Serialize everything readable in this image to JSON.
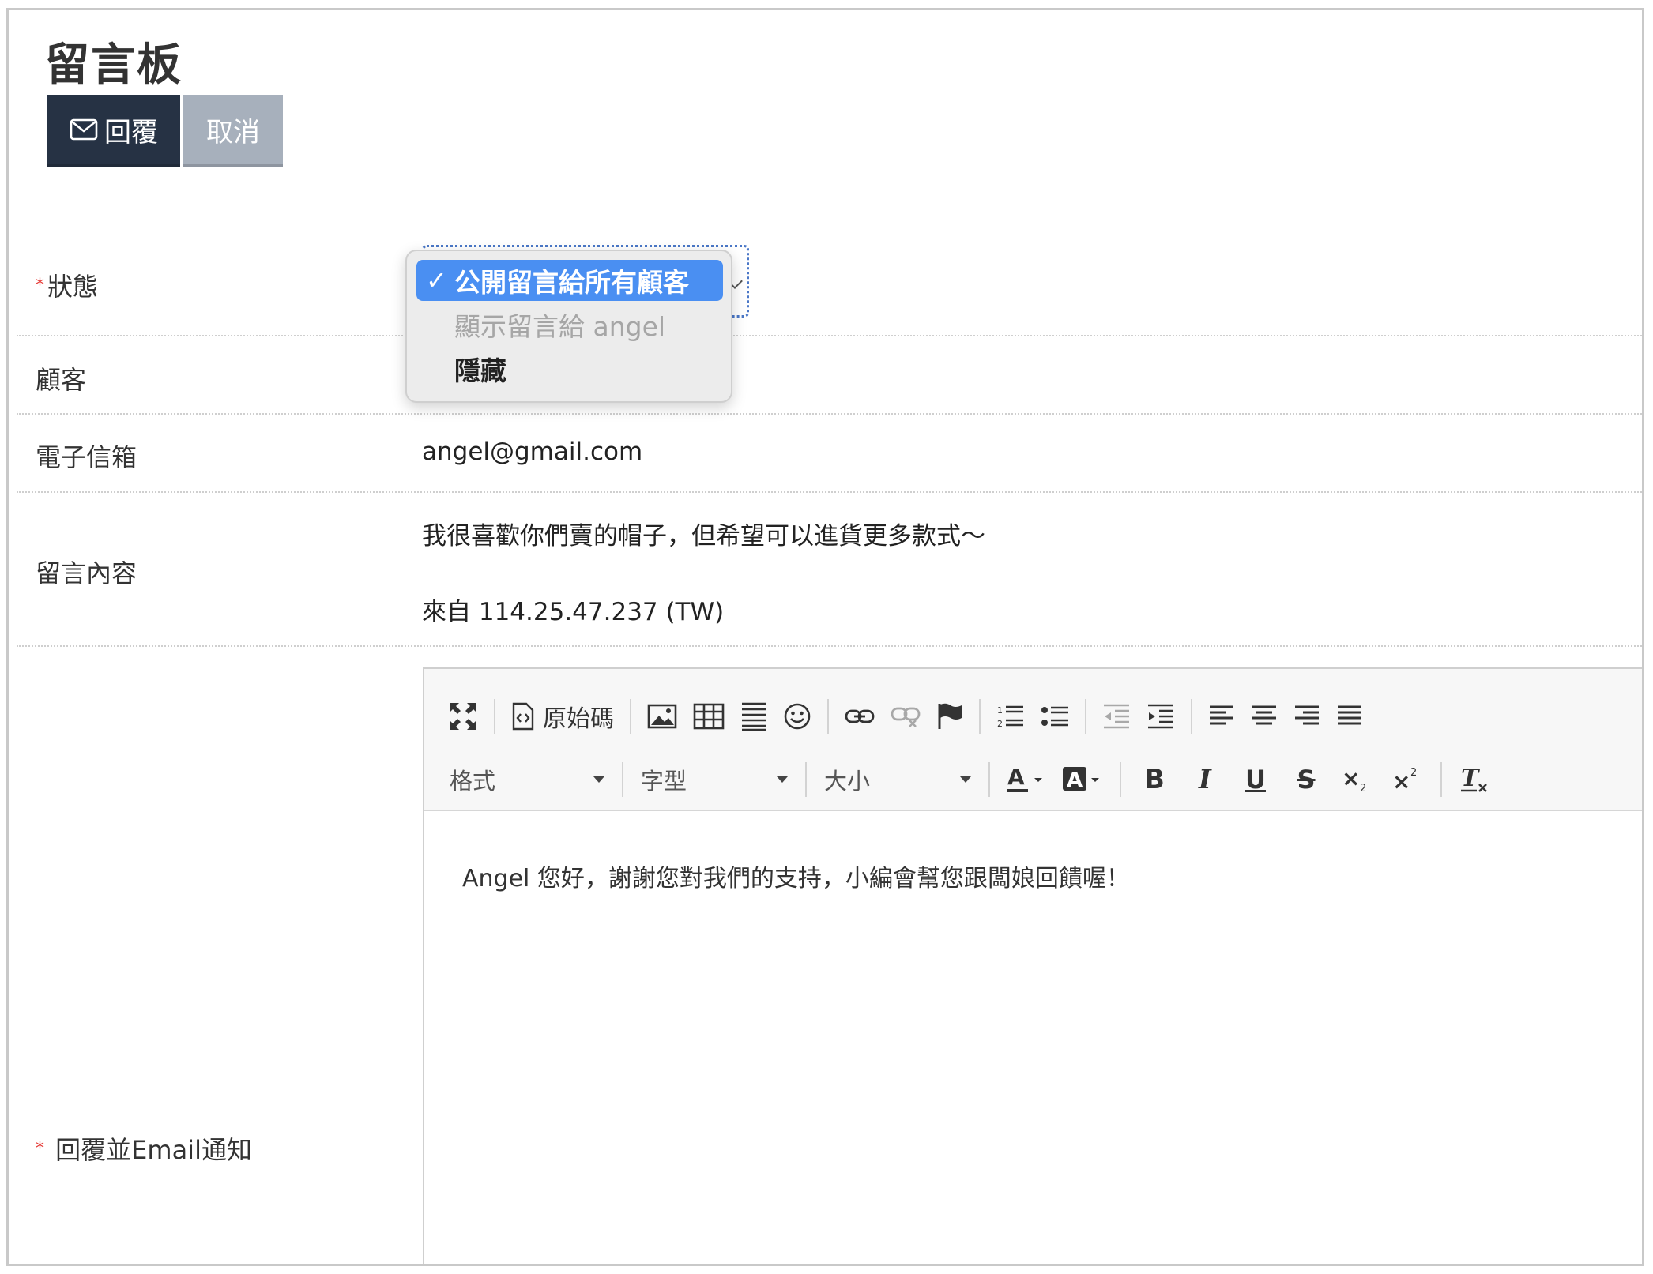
{
  "page": {
    "title": "留言板"
  },
  "actions": {
    "reply_label": "回覆",
    "cancel_label": "取消"
  },
  "form": {
    "status": {
      "label": "狀態",
      "options": [
        "公開留言給所有顧客",
        "顯示留言給 angel",
        "隱藏"
      ],
      "selected_index": 0,
      "disabled_index": 1
    },
    "customer": {
      "label": "顧客"
    },
    "email": {
      "label": "電子信箱",
      "value": "angel@gmail.com"
    },
    "message": {
      "label": "留言內容",
      "text": "我很喜歡你們賣的帽子，但希望可以進貨更多款式～",
      "origin": "來自 114.25.47.237 (TW)"
    },
    "reply": {
      "label": "回覆並Email通知",
      "content": "Angel 您好，謝謝您對我們的支持，小編會幫您跟闆娘回饋喔！"
    }
  },
  "editor": {
    "source_label": "原始碼",
    "format_label": "格式",
    "font_label": "字型",
    "size_label": "大小",
    "icons": [
      "maximize-icon",
      "source-icon",
      "image-icon",
      "table-icon",
      "horizontal-rule-icon",
      "smiley-icon",
      "link-icon",
      "unlink-icon",
      "anchor-flag-icon",
      "numbered-list-icon",
      "bulleted-list-icon",
      "outdent-icon",
      "indent-icon",
      "align-left-icon",
      "align-center-icon",
      "align-right-icon",
      "align-justify-icon",
      "text-color-icon",
      "background-color-icon",
      "bold-icon",
      "italic-icon",
      "underline-icon",
      "strikethrough-icon",
      "subscript-icon",
      "superscript-icon",
      "remove-format-icon"
    ],
    "colors": {
      "accent": "#4a8ff2",
      "primary_button": "#263244",
      "secondary_button": "#a7b0bc"
    }
  }
}
